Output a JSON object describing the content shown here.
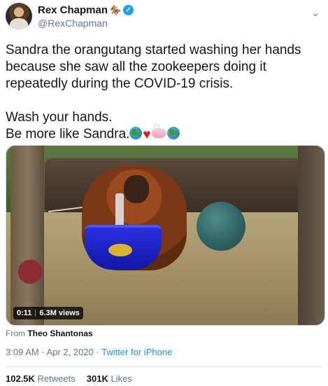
{
  "author": {
    "display_name": "Rex Chapman",
    "handle": "@RexChapman"
  },
  "tweet": {
    "line1": "Sandra the orangutang started washing her hands",
    "line2": "because she saw all the zookeepers doing it",
    "line3": "repeatedly during the COVID-19 crisis.",
    "line4": "Wash your hands.",
    "line5": "Be more like Sandra."
  },
  "media": {
    "duration": "0:11",
    "views": "6.3M views"
  },
  "attribution": {
    "prefix": "From",
    "source": "Theo Shantonas"
  },
  "meta": {
    "time": "3:09 AM",
    "dot1": "·",
    "date": "Apr 2, 2020",
    "dot2": "·",
    "client": "Twitter for iPhone"
  },
  "stats": {
    "retweets_count": "102.5K",
    "retweets_label": "Retweets",
    "likes_count": "301K",
    "likes_label": "Likes"
  },
  "icons": {
    "verified": "verified-badge-icon",
    "horse": "horse-emoji-icon",
    "more": "chevron-down-icon",
    "globe": "globe-emoji-icon",
    "heart": "heart-emoji-icon",
    "soap": "soap-emoji-icon"
  },
  "colors": {
    "link": "#1b95e0",
    "verified": "#1da1f2",
    "muted": "#657786",
    "text": "#14171a"
  }
}
